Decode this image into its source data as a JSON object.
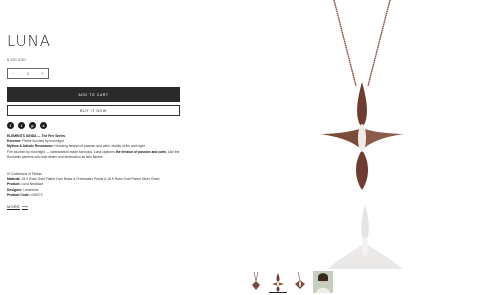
{
  "product": {
    "title": "LUNA",
    "price": "$ 250 SGD",
    "quantity": "1",
    "qty_minus": "−",
    "qty_plus": "+",
    "add_to_cart": "ADD TO CART",
    "buy_now": "BUY IT NOW"
  },
  "social": [
    {
      "icon": "facebook-icon",
      "glyph": "f"
    },
    {
      "icon": "twitter-icon",
      "glyph": "t"
    },
    {
      "icon": "pinterest-icon",
      "glyph": "p"
    },
    {
      "icon": "share-icon",
      "glyph": "s"
    }
  ],
  "description": {
    "series": "ELEMENTS IONDA — The Fire Series",
    "essence_label": "Essence:",
    "essence_value": "Flame touched by moonlight",
    "mythos_label": "Mythos & Artistic Resonance:",
    "mythos_value": "Honoring tension of passion and calm, duality of fire and night",
    "body_pre": "Fire touched by moonlight — contradiction made luminous. Luna captures",
    "body_bold": "the tension of passion and calm.",
    "body_post": "Like the Romantic painters who saw desire and destruction as twin flames.",
    "collection": "IV Collections of Fiertas",
    "material_label": "Material:",
    "material_value": "18 K Rose Gold Plated Over Brass & Freshwater Pearls & 18 K Rose Gold Plated Silver Chain",
    "product_label": "Product:",
    "product_value": "Luna Necklace",
    "designer_label": "Designer:",
    "designer_value": "Lunarionis",
    "code_label": "Product Code:",
    "code_value": "LNE072"
  },
  "more_link": "MORE",
  "colors": {
    "accent": "#2a2a2a",
    "rose_gold": "#8a5a4a",
    "pearl": "#f0ebe6"
  }
}
